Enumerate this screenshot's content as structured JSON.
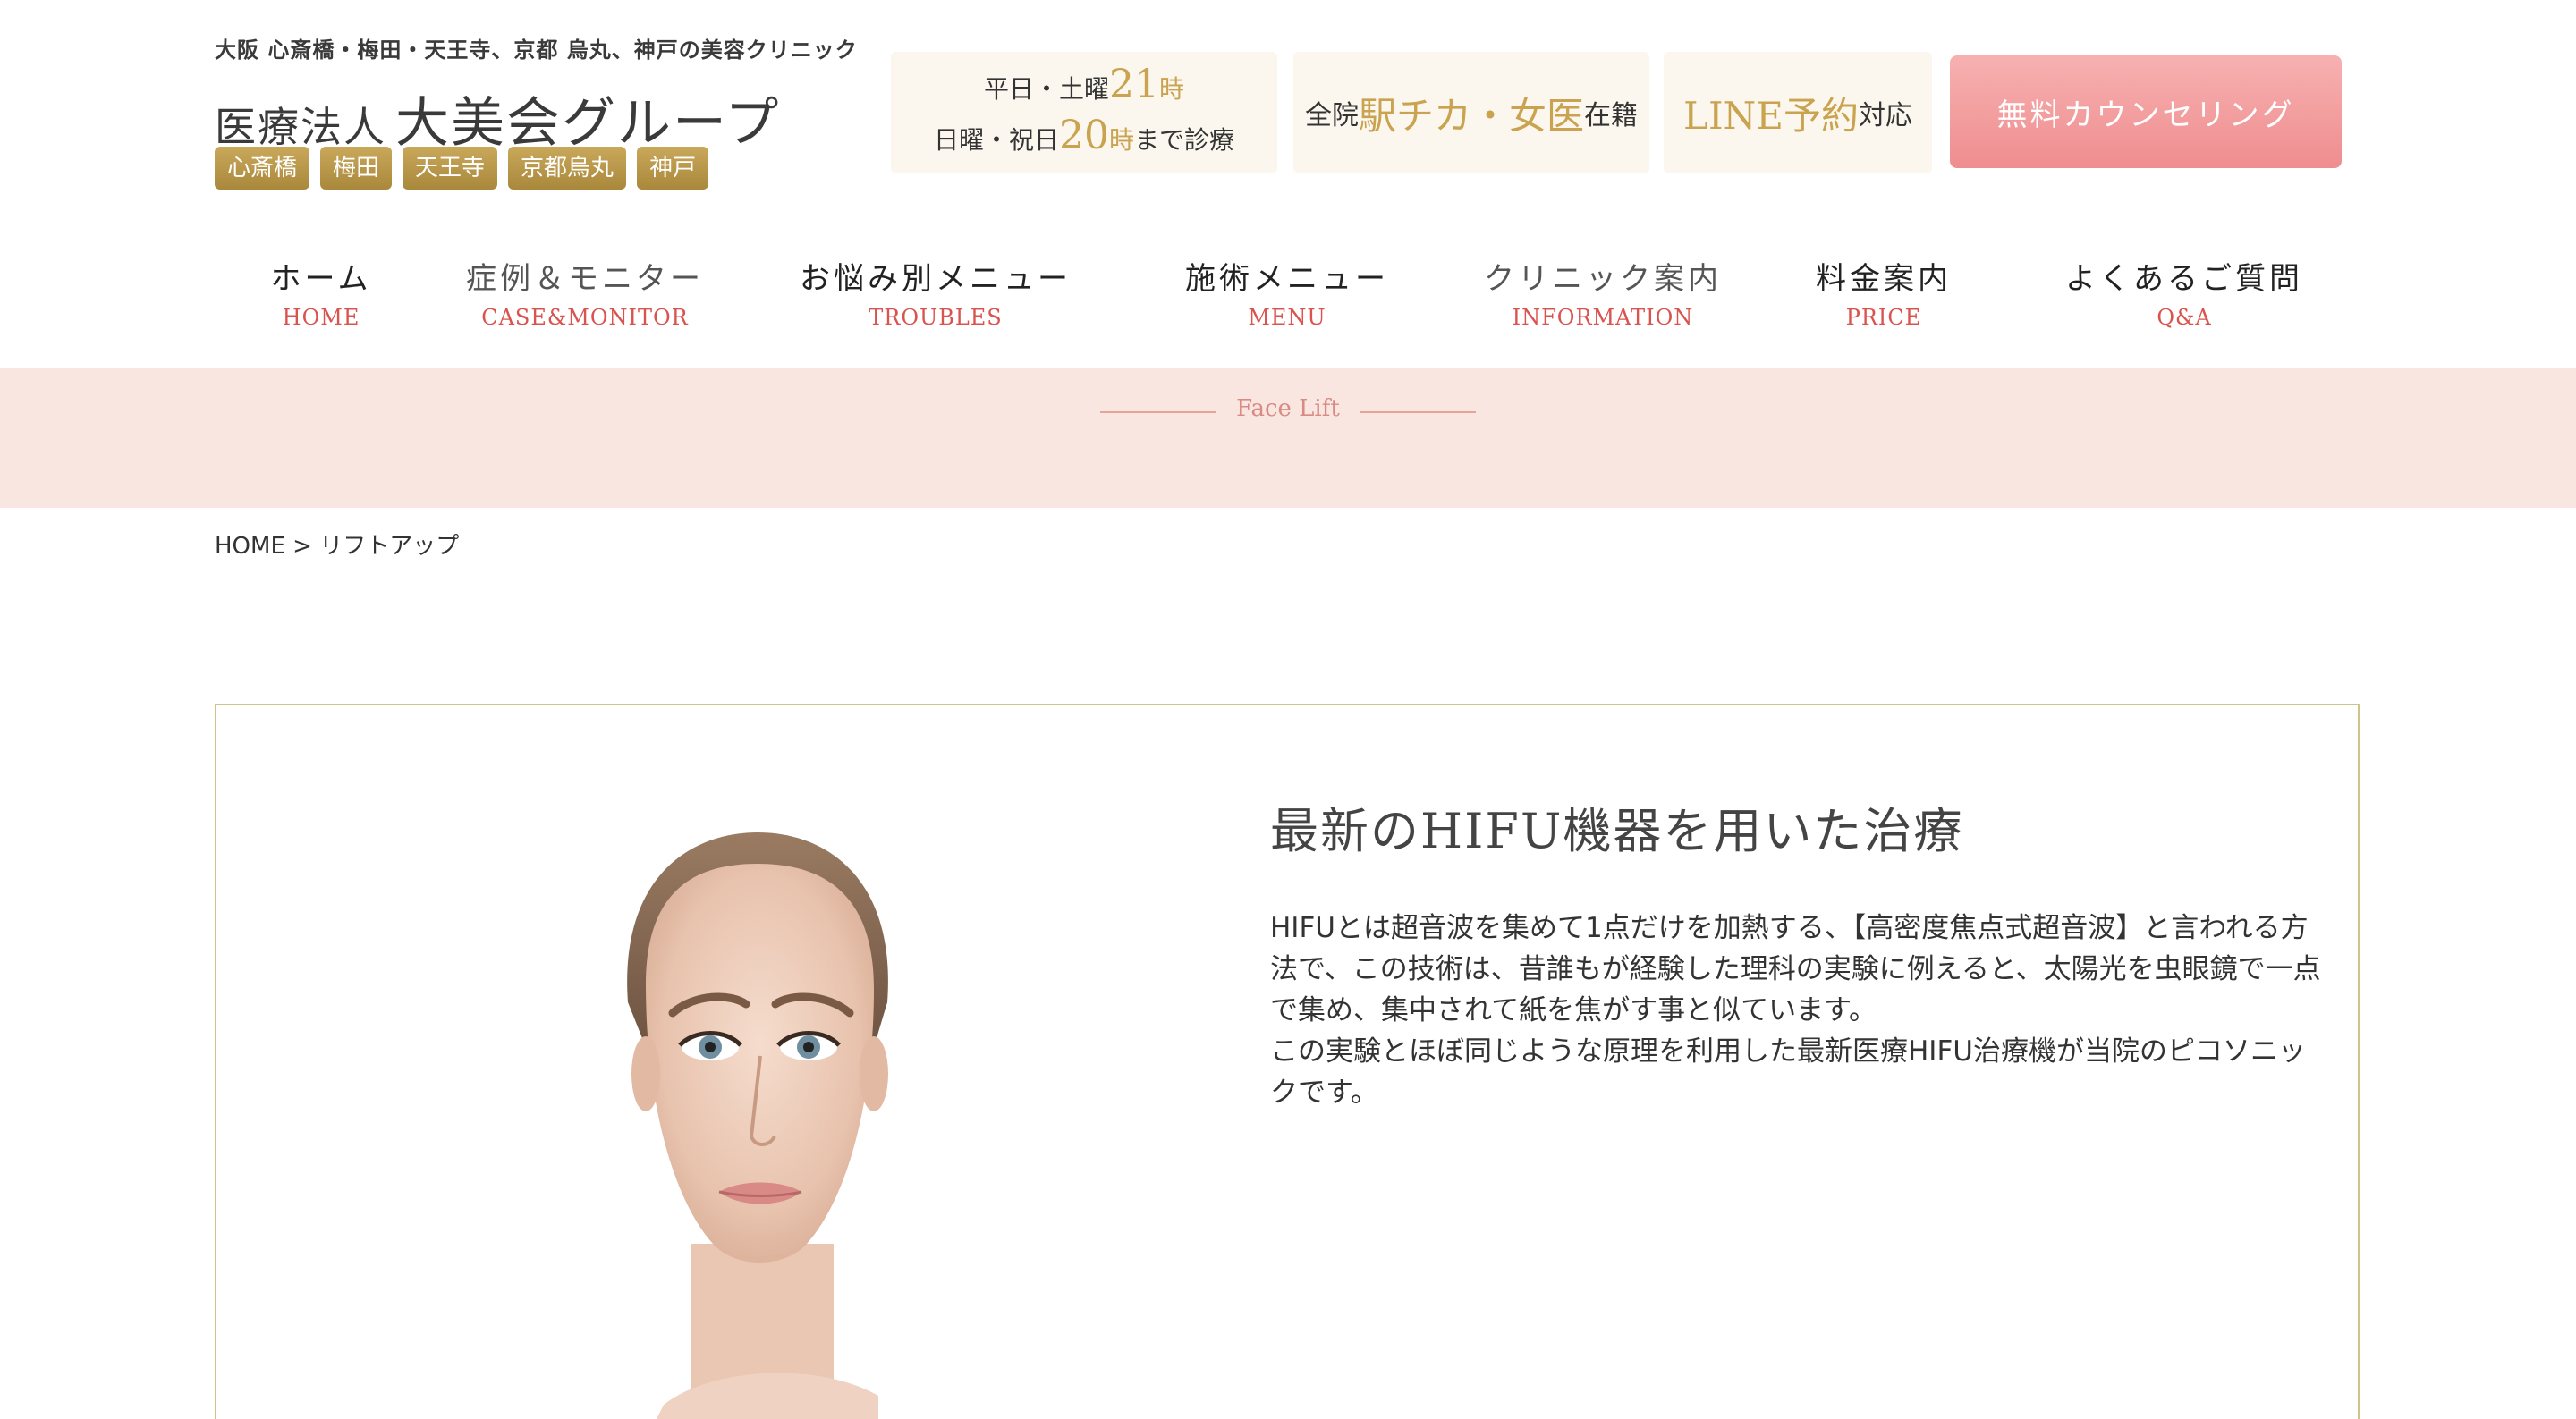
{
  "header": {
    "tagline": "大阪 心斎橋・梅田・天王寺、京都 烏丸、神戸の美容クリニック",
    "logo_prefix": "医療法人",
    "logo_main": "大美会グループ",
    "branches": [
      "心斎橋",
      "梅田",
      "天王寺",
      "京都烏丸",
      "神戸"
    ],
    "hours": {
      "line1_pre": "平日・土曜",
      "line1_num": "21",
      "line1_suf": "時",
      "line2_pre": "日曜・祝日",
      "line2_num": "20",
      "line2_suf": "時",
      "line2_end": "まで診療"
    },
    "staff": {
      "pre": "全院",
      "gold": "駅チカ・女医",
      "suf": "在籍"
    },
    "line_booking": {
      "gold": "LINE予約",
      "suf": "対応"
    },
    "counsel_button": "無料カウンセリング"
  },
  "nav": [
    {
      "jp": "ホーム",
      "en": "HOME"
    },
    {
      "jp": "症例＆モニター",
      "en": "CASE&MONITOR"
    },
    {
      "jp": "お悩み別メニュー",
      "en": "TROUBLES"
    },
    {
      "jp": "施術メニュー",
      "en": "MENU"
    },
    {
      "jp": "クリニック案内",
      "en": "INFORMATION"
    },
    {
      "jp": "料金案内",
      "en": "PRICE"
    },
    {
      "jp": "よくあるご質問",
      "en": "Q&A"
    }
  ],
  "hero": {
    "title": "Face Lift"
  },
  "breadcrumb": {
    "home": "HOME",
    "separator": ">",
    "current": "リフトアップ"
  },
  "section": {
    "title": "最新のHIFU機器を用いた治療",
    "para1": "HIFUとは超音波を集めて1点だけを加熱する、【高密度焦点式超音波】と言われる方法で、この技術は、昔誰もが経験した理科の実験に例えると、太陽光を虫眼鏡で一点で集め、集中されて紙を焦がす事と似ています。",
    "para2": "この実験とほぼ同じような原理を利用した最新医療HIFU治療機が当院のピコソニックです。"
  },
  "colors": {
    "gold": "#c9a34f",
    "pink_button": "#ef8d8f",
    "hero_bg": "#f9e6e1",
    "nav_en": "#d9534f",
    "box_border": "#cfc48a"
  }
}
